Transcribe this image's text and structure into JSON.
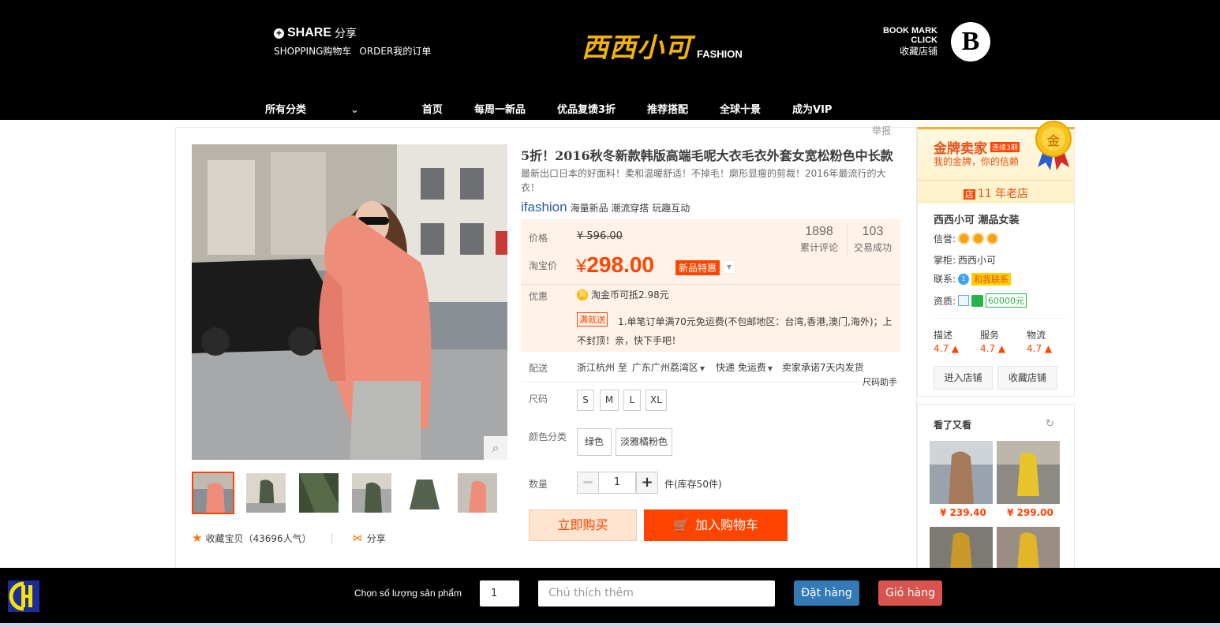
{
  "header": {
    "share": "SHARE",
    "share_cn": "分享",
    "shopping": "SHOPPING购物车",
    "order": "ORDER我的订单",
    "logo_cn": "西西小可",
    "logo_en": "FASHION",
    "bookmark_1": "BOOK MARK",
    "bookmark_2": "CLICK",
    "bookmark_cn": "收藏店铺",
    "brand_letter": "B"
  },
  "nav": {
    "items": [
      "所有分类",
      "首页",
      "每周一新品",
      "优品复馈3折",
      "推荐搭配",
      "全球十景",
      "成为VIP"
    ]
  },
  "report": "举报",
  "product": {
    "title": "5折！2016秋冬新款韩版高端毛呢大衣毛衣外套女宽松粉色中长款",
    "subtitle": "最新出口日本的好面料！柔和温暖舒适！不掉毛！廓形显瘦的剪裁！2016年最流行的大衣！",
    "ifashion_brand": "ifashion",
    "ifashion_tags": "海量新品 潮流穿搭 玩趣互动",
    "price_label": "价格",
    "old_price": "¥ 596.00",
    "taobao_price_label": "淘宝价",
    "yen": "¥",
    "price": "298.00",
    "price_badge": "新品特惠",
    "reviews_count": "1898",
    "reviews_label": "累计评论",
    "sales_count": "103",
    "sales_label": "交易成功",
    "promo_label": "优惠",
    "coin_text": "淘金币可抵2.98元",
    "coin_icon": "淘",
    "manjiu_badge": "满就送",
    "manjiu_text": "1.单笔订单满70元免运费(不包邮地区：台湾,香港,澳门,海外)；上不封顶！亲，快下手吧！",
    "delivery_label": "配送",
    "ship_from": "浙江杭州 至",
    "ship_to": "广东广州荔湾区",
    "ship_method": "快递 免运费",
    "ship_promise": "卖家承诺7天内发货",
    "size_help": "尺码助手",
    "size_label": "尺码",
    "sizes": [
      "S",
      "M",
      "L",
      "XL"
    ],
    "color_label": "颜色分类",
    "colors": [
      "绿色",
      "淡雅橘粉色"
    ],
    "qty_label": "数量",
    "qty_value": "1",
    "qty_minus": "−",
    "qty_plus": "+",
    "stock": "件(库存50件)",
    "buy_now": "立即购买",
    "add_cart": "加入购物车",
    "favorite": "收藏宝贝（43696人气）",
    "share": "分享"
  },
  "seller": {
    "gold_title": "金牌卖家",
    "gold_level": "连续3期",
    "gold_sub": "我的金牌，你的信赖",
    "medal_text": "金",
    "years_icon": "店",
    "years": "11 年老店",
    "shop_name": "西西小可 潮品女装",
    "credit_label": "信誉:",
    "keeper_label": "掌柜:",
    "keeper_name": "西西小可",
    "contact_label": "联系:",
    "contact_btn": "和我联系",
    "qual_label": "资质:",
    "guarantee": "60000元",
    "ratings": [
      {
        "label": "描述",
        "value": "4.7 ▲"
      },
      {
        "label": "服务",
        "value": "4.7 ▲"
      },
      {
        "label": "物流",
        "value": "4.7 ▲"
      }
    ],
    "enter_shop": "进入店铺",
    "fav_shop": "收藏店铺"
  },
  "also_viewed": {
    "title": "看了又看",
    "prices": [
      "¥ 239.40",
      "¥ 299.00"
    ]
  },
  "bottom_bar": {
    "qty_label": "Chọn số lượng sản phẩm",
    "qty_value": "1",
    "note_placeholder": "Chú thích thêm",
    "order_btn": "Đặt hàng",
    "cart_btn": "Giỏ hàng"
  }
}
